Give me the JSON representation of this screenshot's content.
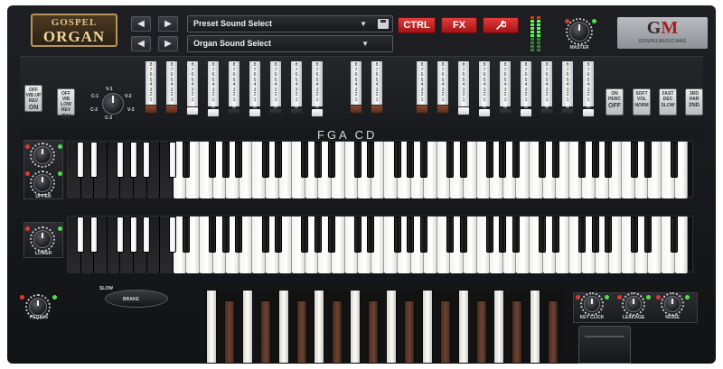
{
  "app": {
    "logo_line1": "GOSPEL",
    "logo_line2": "ORGAN",
    "brand_initials_g": "G",
    "brand_initials_m": "M",
    "brand_subtitle": "GOSPELMUSICIANS"
  },
  "header": {
    "prev_icon": "◀",
    "next_icon": "▶",
    "preset_select": "Preset Sound Select",
    "organ_select": "Organ Sound Select",
    "caret": "▼",
    "ctrl_label": "CTRL",
    "fx_label": "FX",
    "settings_icon_name": "wrench-icon",
    "master_label": "MASTER"
  },
  "left_switches": {
    "vib_upper": {
      "top": "OFF",
      "mid": "VIB UP",
      "sub": "REV",
      "big": "ON"
    },
    "vib_lower": {
      "top": "OFF",
      "mid": "VIB LOW",
      "sub": "REV",
      "big": "ON"
    },
    "vibrato_selector": {
      "labels": [
        "V-1",
        "V-2",
        "V-3",
        "C-1",
        "C-2",
        "C-3"
      ]
    }
  },
  "drawbar_numbers": "87654321",
  "drawbar_keys_label": "FGA CD",
  "right_switches": [
    {
      "top": "ON",
      "mid": "PERC",
      "big": "OFF"
    },
    {
      "top": "SOFT",
      "mid": "VOL",
      "big": "NORM"
    },
    {
      "top": "FAST",
      "mid": "DEC",
      "big": "SLOW"
    },
    {
      "top": "3RD",
      "mid": "HAR",
      "big": "2ND"
    }
  ],
  "manual_labels": {
    "upper": "UPPER",
    "lower": "LOWER",
    "pedals": "PEDALS"
  },
  "leslie": {
    "slow": "SLOW",
    "brake": "BRAKE"
  },
  "bottom_knobs": {
    "key_click": "KEY CLICK",
    "leakage": "LEAKAGE",
    "noise": "NOISE"
  },
  "colors": {
    "accent_red": "#c81c1c",
    "drawbar_brown": "#7a3e28",
    "led_green": "#54ff4f",
    "logo_gold": "#b8935a"
  }
}
